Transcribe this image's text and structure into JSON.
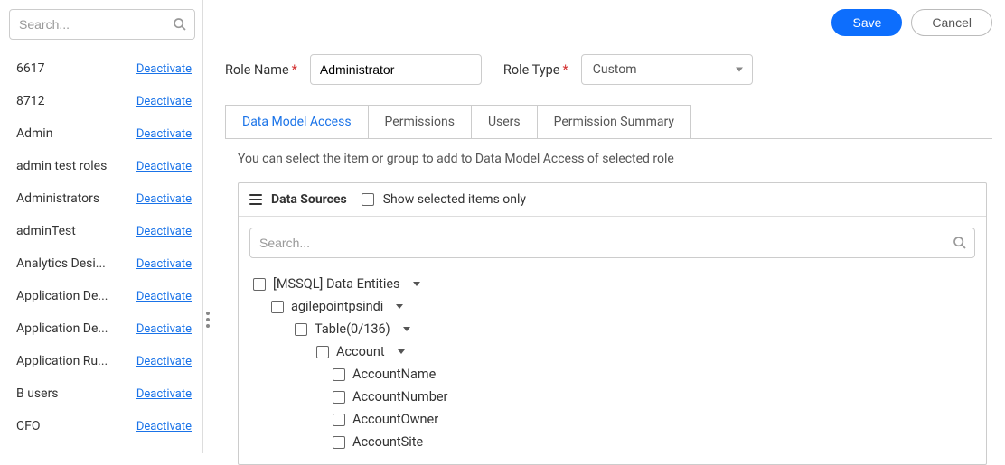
{
  "sidebar": {
    "search_placeholder": "Search...",
    "deactivate_label": "Deactivate",
    "items": [
      {
        "name": "6617"
      },
      {
        "name": "8712"
      },
      {
        "name": "Admin"
      },
      {
        "name": "admin test roles"
      },
      {
        "name": "Administrators"
      },
      {
        "name": "adminTest"
      },
      {
        "name": "Analytics Desi..."
      },
      {
        "name": "Application De..."
      },
      {
        "name": "Application De..."
      },
      {
        "name": "Application Ru..."
      },
      {
        "name": "B users"
      },
      {
        "name": "CFO"
      }
    ]
  },
  "buttons": {
    "save": "Save",
    "cancel": "Cancel"
  },
  "form": {
    "role_name_label": "Role Name",
    "role_name_value": "Administrator",
    "role_type_label": "Role Type",
    "role_type_value": "Custom"
  },
  "tabs": [
    "Data Model Access",
    "Permissions",
    "Users",
    "Permission Summary"
  ],
  "hint": "You can select the item or group to add to Data Model Access of selected role",
  "panel": {
    "title": "Data Sources",
    "show_selected_label": "Show selected items only",
    "search_placeholder": "Search..."
  },
  "tree": {
    "l0": "[MSSQL] Data Entities",
    "l1": "agilepointpsindi",
    "l2": "Table(0/136)",
    "l3": "Account",
    "leaves": [
      "AccountName",
      "AccountNumber",
      "AccountOwner",
      "AccountSite"
    ]
  }
}
